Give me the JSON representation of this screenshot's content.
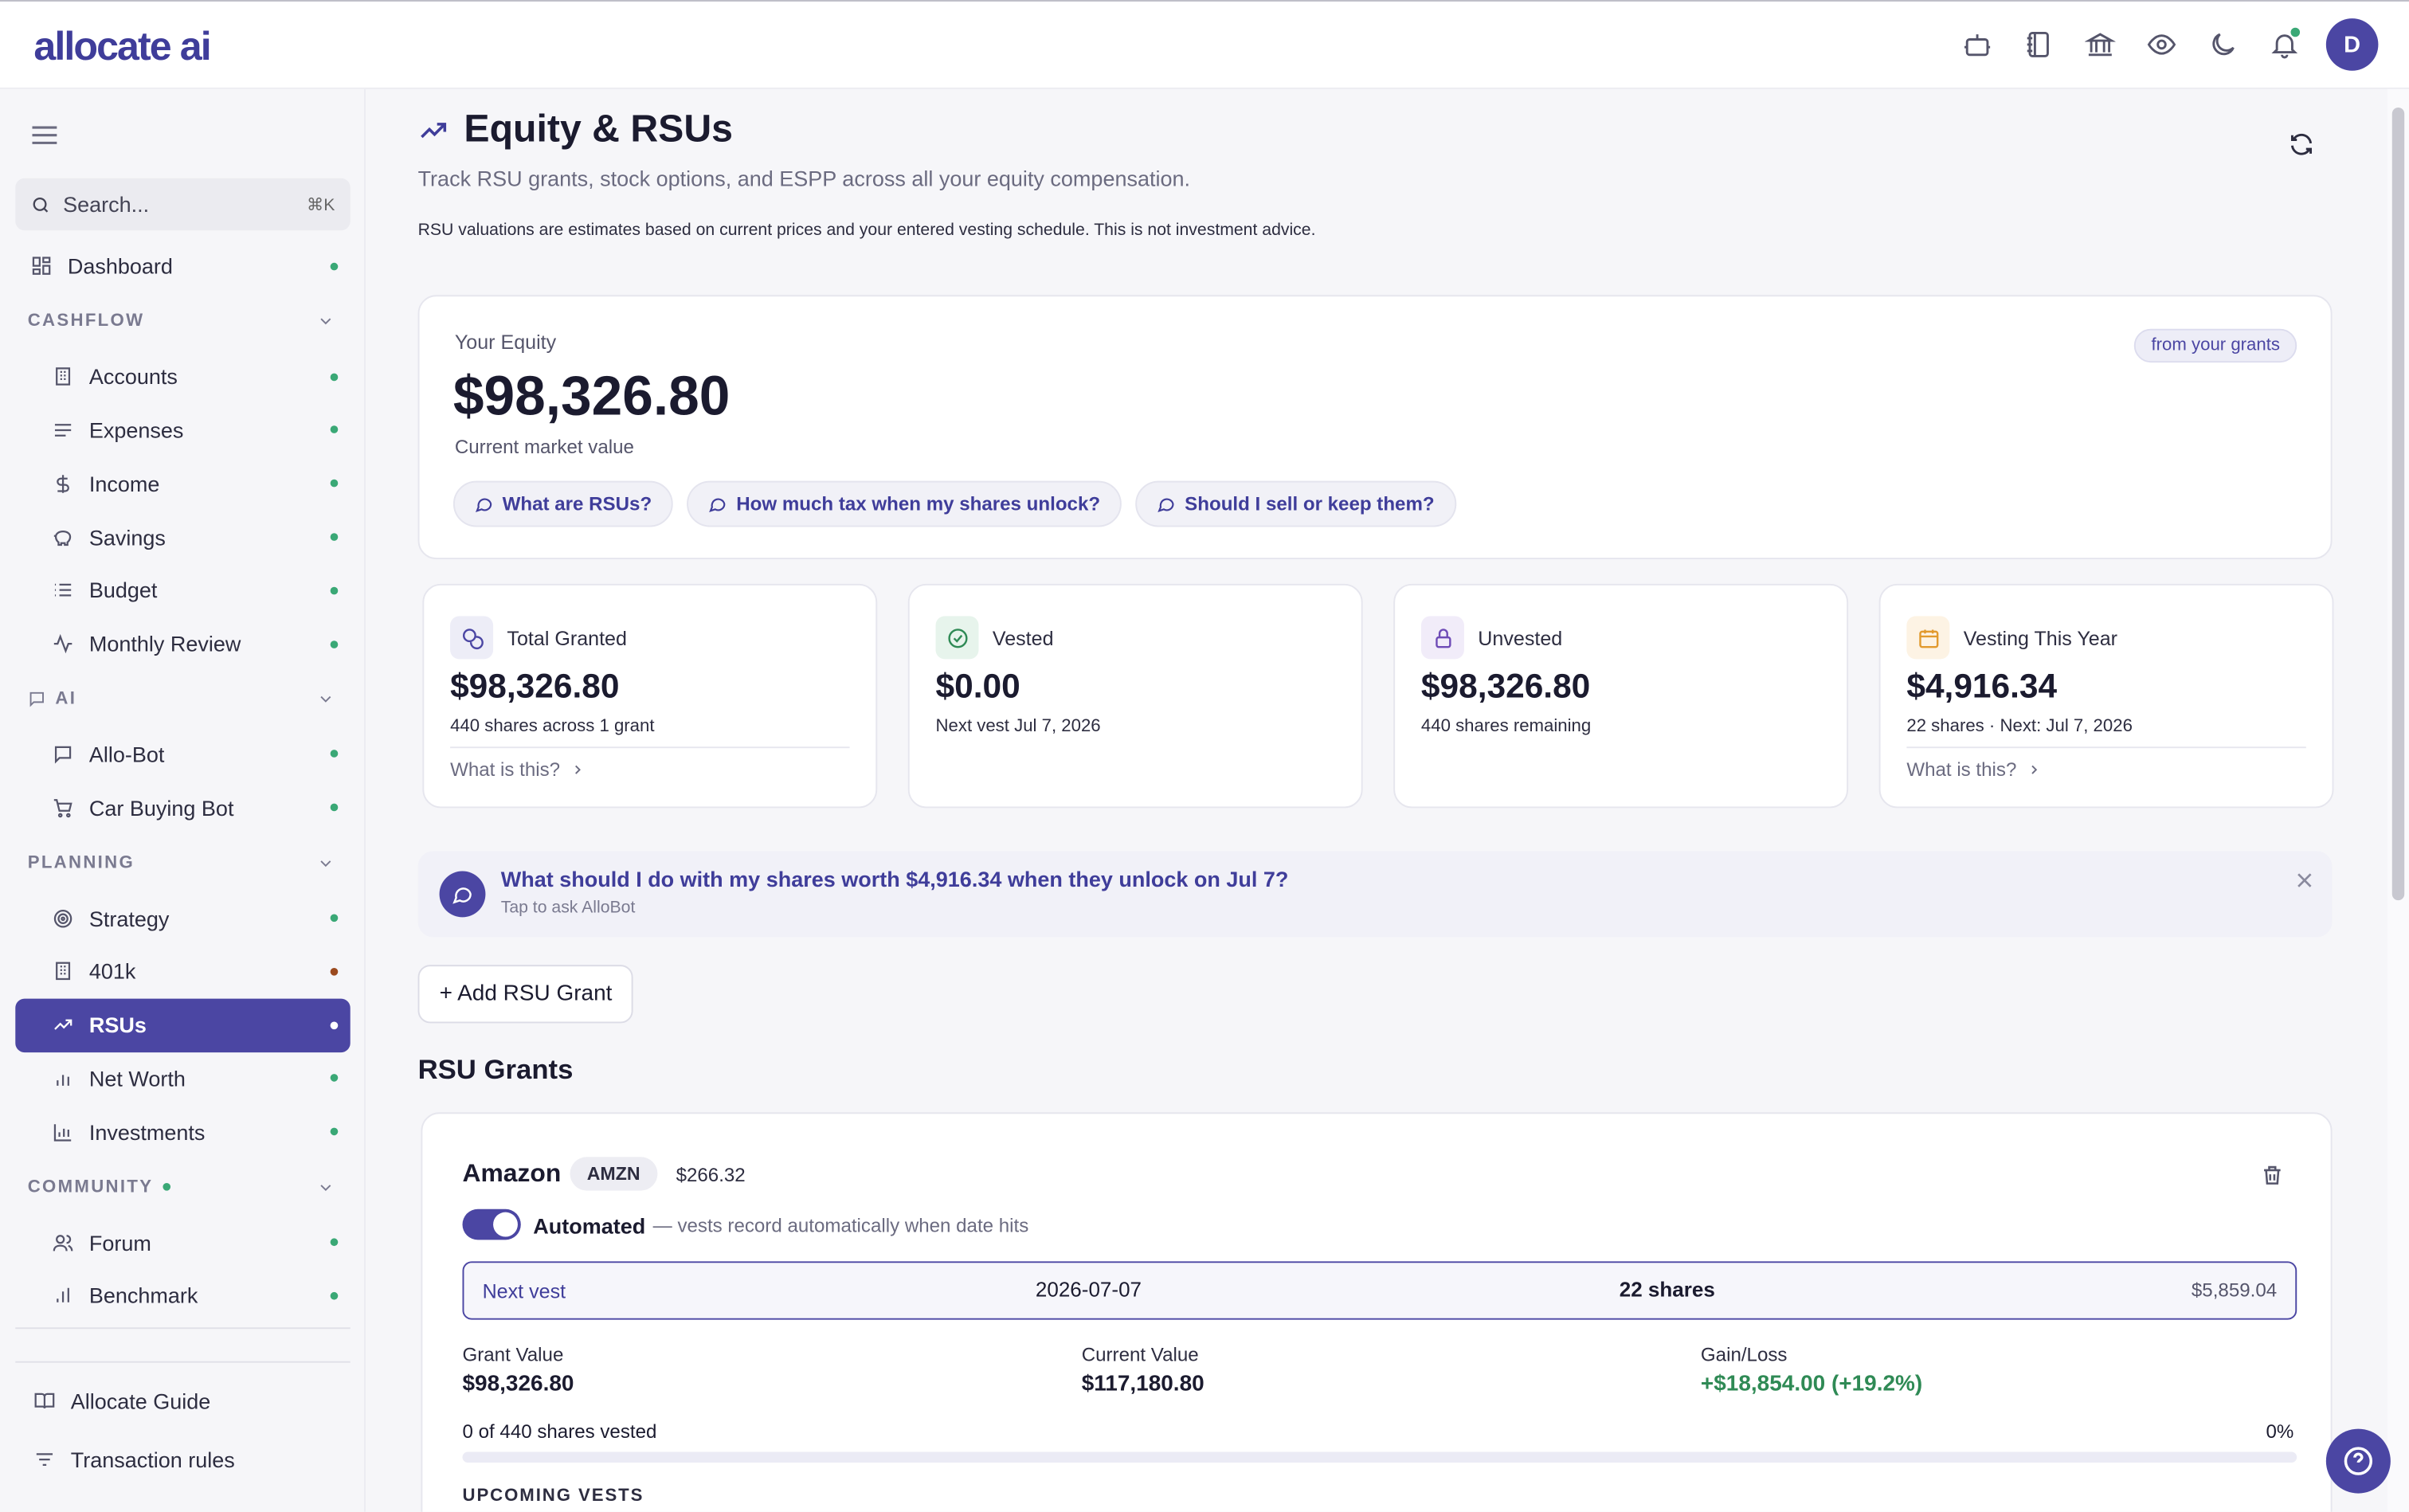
{
  "app": {
    "logo": "allocate ai",
    "avatar_initial": "D"
  },
  "colors": {
    "accent": "#4b46a3",
    "positive": "#2f8a55",
    "status_dot": "#3aa876",
    "warning_dot": "#9b4a1f"
  },
  "topbar": {
    "icons": [
      "bot-icon",
      "notebook-icon",
      "bank-icon",
      "eye-icon",
      "moon-icon",
      "bell-icon"
    ]
  },
  "sidebar": {
    "search_placeholder": "Search...",
    "search_shortcut": "⌘K",
    "dashboard": "Dashboard",
    "sections": {
      "cashflow": "CASHFLOW",
      "ai": "AI",
      "planning": "PLANNING",
      "community": "COMMUNITY"
    },
    "cashflow_items": [
      "Accounts",
      "Expenses",
      "Income",
      "Savings",
      "Budget",
      "Monthly Review"
    ],
    "ai_items": [
      "Allo-Bot",
      "Car Buying Bot"
    ],
    "planning_items": [
      "Strategy",
      "401k",
      "RSUs",
      "Net Worth",
      "Investments"
    ],
    "community_items": [
      "Forum",
      "Benchmark"
    ],
    "footer": {
      "guide": "Allocate Guide",
      "rules": "Transaction rules"
    }
  },
  "page": {
    "title": "Equity & RSUs",
    "subtitle": "Track RSU grants, stock options, and ESPP across all your equity compensation.",
    "disclaimer": "RSU valuations are estimates based on current prices and your entered vesting schedule. This is not investment advice."
  },
  "equity": {
    "label": "Your Equity",
    "value": "$98,326.80",
    "sub": "Current market value",
    "tag": "from your grants",
    "chips": [
      "What are RSUs?",
      "How much tax when my shares unlock?",
      "Should I sell or keep them?"
    ]
  },
  "stats": [
    {
      "title": "Total Granted",
      "value": "$98,326.80",
      "sub": "440 shares across 1 grant",
      "link": "What is this?"
    },
    {
      "title": "Vested",
      "value": "$0.00",
      "sub": "Next vest Jul 7, 2026"
    },
    {
      "title": "Unvested",
      "value": "$98,326.80",
      "sub": "440 shares remaining"
    },
    {
      "title": "Vesting This Year",
      "value": "$4,916.34",
      "sub": "22 shares · Next: Jul 7, 2026",
      "link": "What is this?"
    }
  ],
  "banner": {
    "question": "What should I do with my shares worth $4,916.34 when they unlock on Jul 7?",
    "sub": "Tap to ask AlloBot"
  },
  "actions": {
    "add_grant": "+ Add RSU Grant"
  },
  "grants_heading": "RSU Grants",
  "grant": {
    "name": "Amazon",
    "ticker": "AMZN",
    "price": "$266.32",
    "automated_label": "Automated",
    "automated_desc": "— vests record automatically when date hits",
    "next_vest": {
      "label": "Next vest",
      "date": "2026-07-07",
      "shares": "22 shares",
      "amount": "$5,859.04"
    },
    "grant_value": {
      "label": "Grant Value",
      "value": "$98,326.80"
    },
    "current_value": {
      "label": "Current Value",
      "value": "$117,180.80"
    },
    "gain_loss": {
      "label": "Gain/Loss",
      "value": "+$18,854.00 (+19.2%)"
    },
    "progress_label": "0 of 440 shares vested",
    "progress_pct": "0%",
    "progress_fraction": 0,
    "upcoming_heading": "UPCOMING VESTS"
  }
}
